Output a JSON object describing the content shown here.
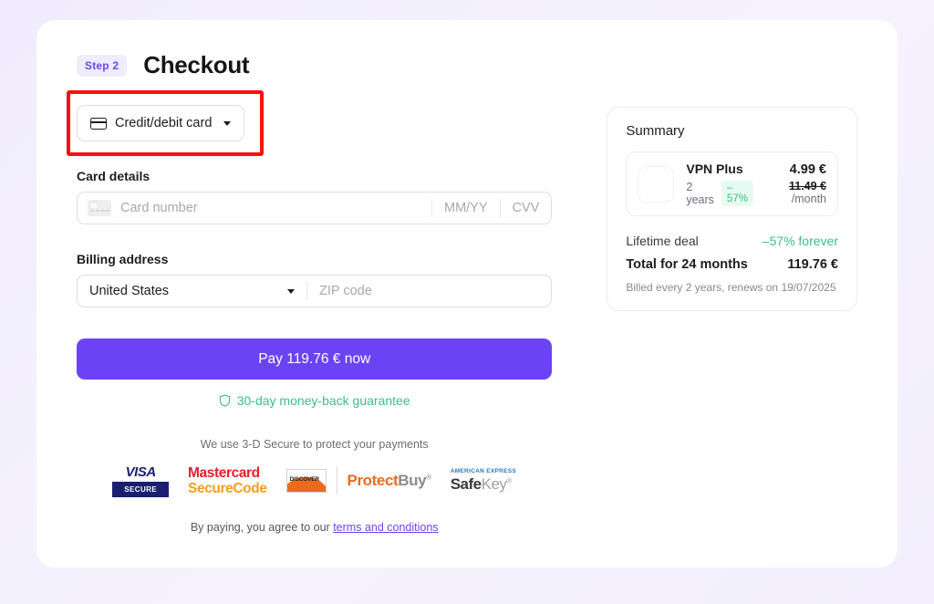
{
  "header": {
    "step_badge": "Step 2",
    "title": "Checkout"
  },
  "payment_method": {
    "selected": "Credit/debit card",
    "icon": "credit-card-icon",
    "caret_icon": "chevron-down-icon",
    "highlight_color": "#f91010"
  },
  "card_details": {
    "label": "Card details",
    "card_number_placeholder": "Card number",
    "expiry_placeholder": "MM/YY",
    "cvv_placeholder": "CVV",
    "card_icon": "card-placeholder-icon"
  },
  "billing_address": {
    "label": "Billing address",
    "country_value": "United States",
    "zip_placeholder": "ZIP code",
    "caret_icon": "chevron-down-icon"
  },
  "actions": {
    "pay_button": "Pay 119.76 € now",
    "pay_button_color": "#6c43f4",
    "guarantee_text": "30-day money-back guarantee",
    "guarantee_icon": "shield-icon",
    "guarantee_color": "#3bbd8a"
  },
  "secure": {
    "note": "We use 3-D Secure to protect your payments",
    "badges": [
      {
        "name": "visa-secure-badge",
        "line1": "VISA",
        "line2": "SECURE",
        "color": "#1a1f71"
      },
      {
        "name": "mastercard-securecode-badge",
        "line1": "Mastercard",
        "line2": "SecureCode",
        "color1": "#eb1c2d",
        "color2": "#f79e1b"
      },
      {
        "name": "discover-protectbuy-badge",
        "logo_text": "DISCOVER",
        "line1": "Protect",
        "line2": "Buy",
        "tm": "®",
        "color": "#ec6a1e"
      },
      {
        "name": "amex-safekey-badge",
        "top": "AMERICAN EXPRESS",
        "line1": "Safe",
        "line2": "Key",
        "tm": "®",
        "color": "#2e77bc"
      }
    ]
  },
  "terms": {
    "prefix": "By paying, you agree to our ",
    "link": "terms and conditions"
  },
  "summary": {
    "title": "Summary",
    "plan": {
      "name": "VPN Plus",
      "term": "2 years",
      "discount_chip": "– 57%",
      "price": "4.99 €",
      "old_price": "11.49 €",
      "per": "/month",
      "logo_icon": "vpn-triangle-logo"
    },
    "deal_label": "Lifetime deal",
    "deal_value": "–57% forever",
    "total_label": "Total for 24 months",
    "total_value": "119.76 €",
    "note": "Billed every 2 years, renews on 19/07/2025"
  }
}
